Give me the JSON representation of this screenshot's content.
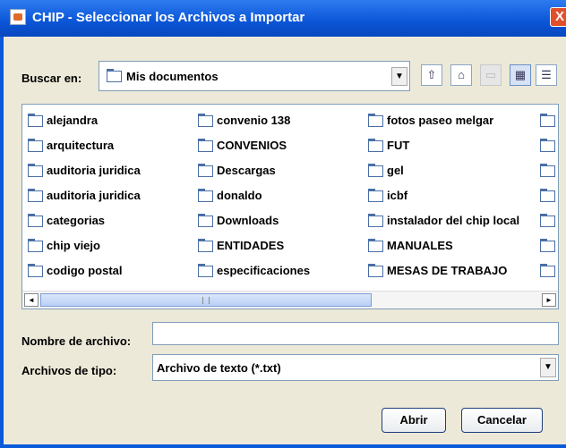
{
  "window": {
    "title": "CHIP - Seleccionar los Archivos a Importar",
    "close_glyph": "X"
  },
  "lookin": {
    "label": "Buscar en:",
    "value": "Mis documentos"
  },
  "toolbar": {
    "up_glyph": "⇧",
    "home_glyph": "⌂",
    "new_folder_glyph": "▭",
    "list_glyph": "▦",
    "details_glyph": "☰"
  },
  "files": {
    "col1": [
      "alejandra",
      "arquitectura",
      "auditoria  juridica",
      "auditoria juridica",
      "categorias",
      "chip viejo",
      "codigo postal"
    ],
    "col2": [
      "convenio 138",
      "CONVENIOS",
      "Descargas",
      "donaldo",
      "Downloads",
      "ENTIDADES",
      "especificaciones"
    ],
    "col3": [
      "fotos paseo melgar",
      "FUT",
      "gel",
      "icbf",
      "instalador  del chip  local",
      "MANUALES",
      "MESAS DE TRABAJO"
    ]
  },
  "scroll": {
    "left_glyph": "◄",
    "right_glyph": "►"
  },
  "filename": {
    "label": "Nombre de archivo:",
    "value": ""
  },
  "filetype": {
    "label": "Archivos de tipo:",
    "value": "Archivo de texto (*.txt)"
  },
  "buttons": {
    "open": "Abrir",
    "cancel": "Cancelar"
  },
  "colors": {
    "title_bar": "#0a55d6",
    "dialog_bg": "#ece9d8",
    "close": "#e0502b"
  }
}
